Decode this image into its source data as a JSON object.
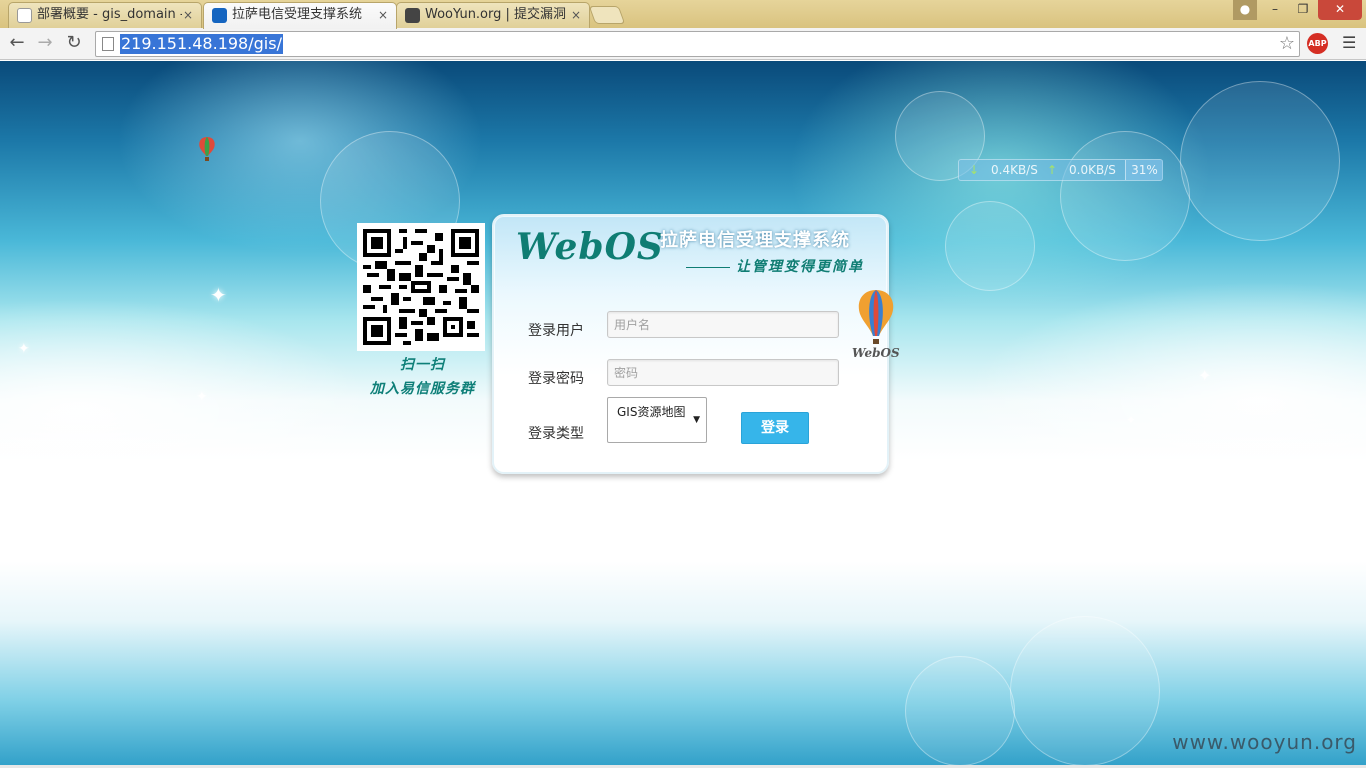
{
  "browser": {
    "tabs": [
      {
        "title": "部署概要 - gis_domain -",
        "active": false,
        "favicon": "page-icon"
      },
      {
        "title": "拉萨电信受理支撑系统",
        "active": true,
        "favicon": "telecom-logo-icon"
      },
      {
        "title": "WooYun.org | 提交漏洞",
        "active": false,
        "favicon": "wooyun-icon"
      }
    ],
    "close_glyph": "×",
    "url": "219.151.48.198/gis/",
    "abp_label": "ABP"
  },
  "page": {
    "net_speed": {
      "down": "0.4KB/S",
      "up": "0.0KB/S",
      "percent": "31%"
    },
    "qr_caption": {
      "line1": "扫一扫",
      "line2": "加入易信服务群"
    },
    "login": {
      "logo": "WebOS",
      "system_title": "拉萨电信受理支撑系统",
      "slogan": "让管理变得更简单",
      "user_label": "登录用户",
      "user_placeholder": "用户名",
      "user_value": "",
      "password_label": "登录密码",
      "password_placeholder": "密码",
      "password_value": "",
      "type_label": "登录类型",
      "type_selected": "GIS资源地图",
      "submit_label": "登录",
      "balloon_text": "WebOS"
    },
    "watermark": "www.wooyun.org"
  },
  "colors": {
    "accent_teal": "#0f7d73",
    "button_blue": "#36b5ea",
    "url_highlight": "#3875d7"
  }
}
